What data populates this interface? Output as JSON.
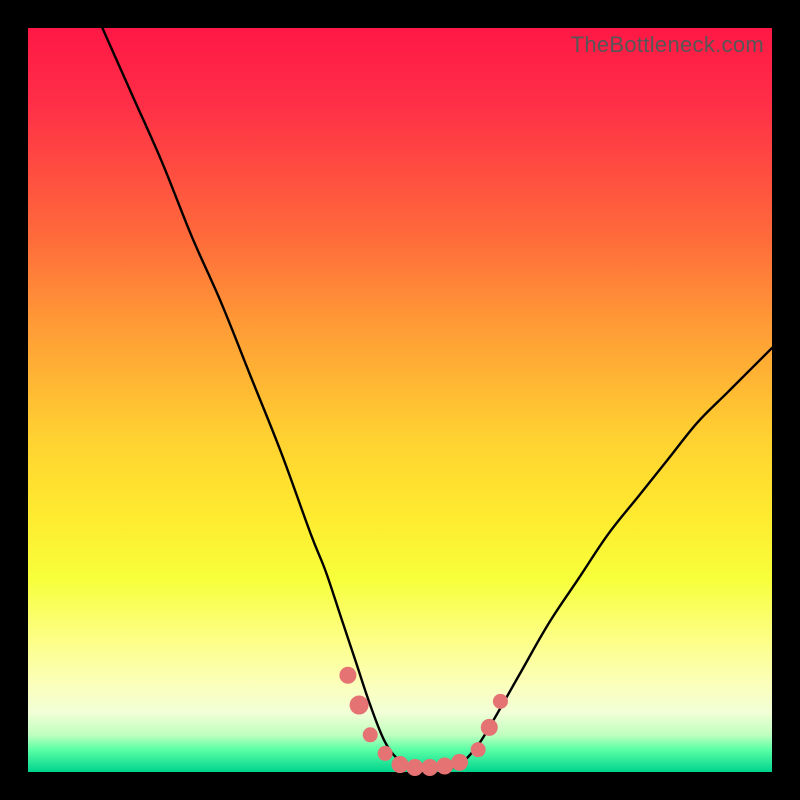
{
  "watermark": "TheBottleneck.com",
  "colors": {
    "curve": "#000000",
    "dot_fill": "#e57373",
    "dot_stroke": "#e57373"
  },
  "chart_data": {
    "type": "line",
    "title": "",
    "xlabel": "",
    "ylabel": "",
    "xlim": [
      0,
      100
    ],
    "ylim": [
      0,
      100
    ],
    "note": "No axes or ticks shown. y=0 is at bottom, y=100 at top. Values estimated from pixel positions against gradient bands.",
    "series": [
      {
        "name": "bottleneck-curve",
        "x": [
          10,
          14,
          18,
          22,
          26,
          30,
          34,
          38,
          40,
          42,
          44,
          46,
          48,
          50,
          52,
          54,
          56,
          58,
          60,
          62,
          66,
          70,
          74,
          78,
          82,
          86,
          90,
          94,
          98,
          100
        ],
        "y": [
          100,
          91,
          82,
          72,
          63,
          53,
          43,
          32,
          27,
          21,
          15,
          9,
          4,
          1.5,
          0.6,
          0.4,
          0.5,
          1,
          3,
          6,
          13,
          20,
          26,
          32,
          37,
          42,
          47,
          51,
          55,
          57
        ]
      }
    ],
    "highlight_points": {
      "name": "lowest-bottleneck-region",
      "points": [
        {
          "x": 43,
          "y": 13,
          "r": 8
        },
        {
          "x": 44.5,
          "y": 9,
          "r": 9
        },
        {
          "x": 46,
          "y": 5,
          "r": 7
        },
        {
          "x": 48,
          "y": 2.5,
          "r": 7
        },
        {
          "x": 50,
          "y": 1,
          "r": 8
        },
        {
          "x": 52,
          "y": 0.6,
          "r": 8
        },
        {
          "x": 54,
          "y": 0.6,
          "r": 8
        },
        {
          "x": 56,
          "y": 0.8,
          "r": 8
        },
        {
          "x": 58,
          "y": 1.3,
          "r": 8
        },
        {
          "x": 60.5,
          "y": 3,
          "r": 7
        },
        {
          "x": 62,
          "y": 6,
          "r": 8
        },
        {
          "x": 63.5,
          "y": 9.5,
          "r": 7
        }
      ]
    }
  }
}
